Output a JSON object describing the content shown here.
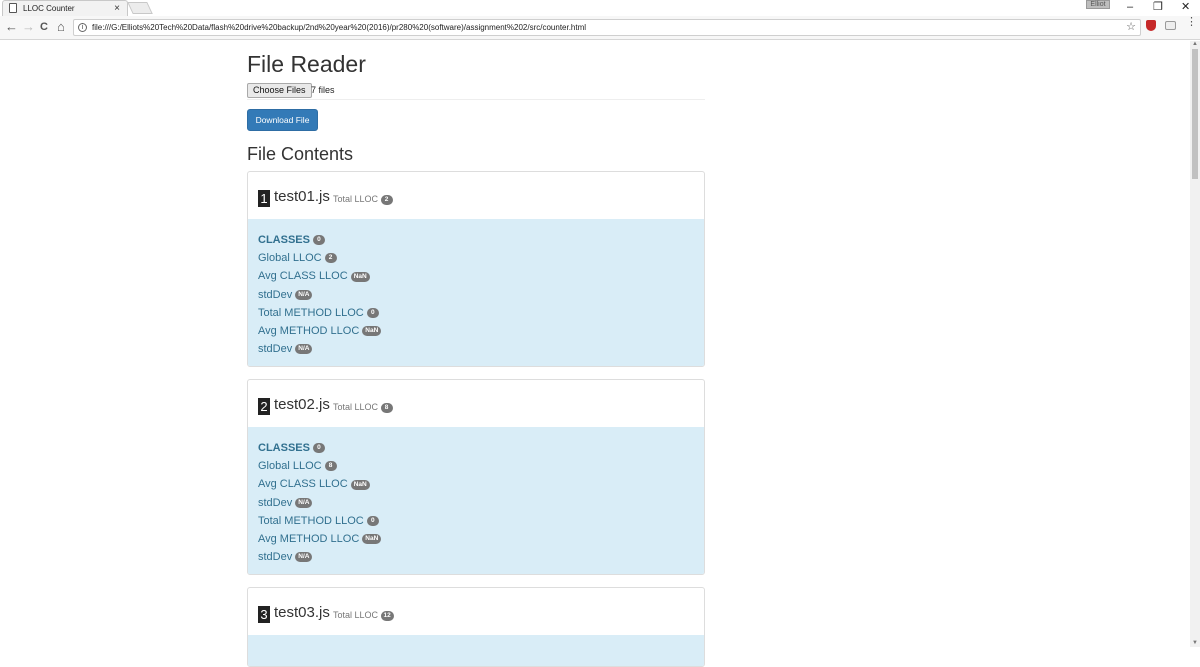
{
  "browser": {
    "tab_title": "LLOC Counter",
    "tab_close": "×",
    "user_badge": "Elliot",
    "url": "file:///G:/Elliots%20Tech%20Data/flash%20drive%20backup/2nd%20year%20(2016)/pr280%20(software)/assignment%202/src/counter.html",
    "win_minimize": "–",
    "win_restore": "❐",
    "win_close": "✕",
    "back": "←",
    "forward": "→",
    "reload": "C",
    "home": "⌂",
    "star": "☆",
    "menu": "⋮"
  },
  "page": {
    "title": "File Reader",
    "choose_files_label": "Choose Files",
    "file_count": "7 files",
    "download_label": "Download File",
    "contents_title": "File Contents"
  },
  "labels": {
    "total_lloc": "Total LLOC",
    "classes": "CLASSES",
    "global_lloc": "Global LLOC",
    "avg_class_lloc": "Avg CLASS LLOC",
    "std_dev": "stdDev",
    "total_method_lloc": "Total METHOD LLOC",
    "avg_method_lloc": "Avg METHOD LLOC"
  },
  "files": [
    {
      "index": "1",
      "name": "test01.js",
      "total": "2",
      "classes": "0",
      "global": "2",
      "avg_class": "NaN",
      "std_class": "N/A",
      "total_method": "0",
      "avg_method": "NaN",
      "std_method": "N/A"
    },
    {
      "index": "2",
      "name": "test02.js",
      "total": "8",
      "classes": "0",
      "global": "8",
      "avg_class": "NaN",
      "std_class": "N/A",
      "total_method": "0",
      "avg_method": "NaN",
      "std_method": "N/A"
    },
    {
      "index": "3",
      "name": "test03.js",
      "total": "12"
    }
  ]
}
